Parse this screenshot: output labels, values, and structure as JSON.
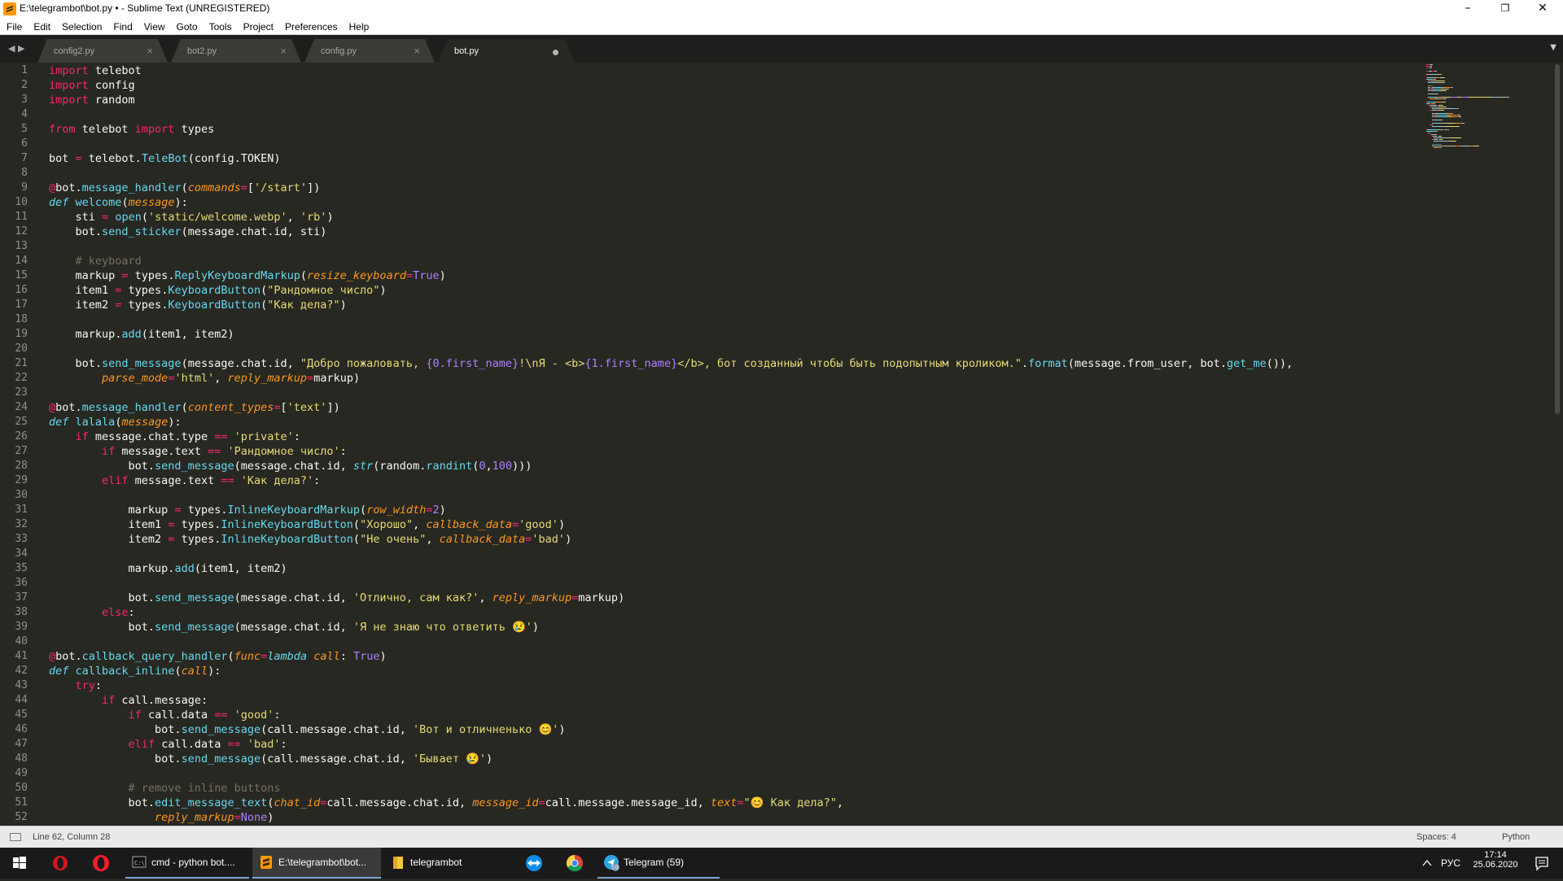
{
  "window": {
    "title": "E:\\telegrambot\\bot.py • - Sublime Text (UNREGISTERED)",
    "minimize": "–",
    "maximize": "❐",
    "close": "✕"
  },
  "menu": [
    "File",
    "Edit",
    "Selection",
    "Find",
    "View",
    "Goto",
    "Tools",
    "Project",
    "Preferences",
    "Help"
  ],
  "tabs": [
    {
      "label": "config2.py",
      "close": "×",
      "active": false
    },
    {
      "label": "bot2.py",
      "close": "×",
      "active": false
    },
    {
      "label": "config.py",
      "close": "×",
      "active": false
    },
    {
      "label": "bot.py",
      "close": "●",
      "active": true
    }
  ],
  "tab_nav": {
    "left": "◀",
    "right": "▶",
    "dropdown": "▼"
  },
  "code": {
    "line_numbers": [
      "1",
      "2",
      "3",
      "4",
      "5",
      "6",
      "7",
      "8",
      "9",
      "10",
      "11",
      "12",
      "13",
      "14",
      "15",
      "16",
      "17",
      "18",
      "19",
      "20",
      "21",
      "22",
      "23",
      "24",
      "25",
      "26",
      "27",
      "28",
      "29",
      "30",
      "31",
      "32",
      "33",
      "34",
      "35",
      "36",
      "37",
      "38",
      "39",
      "40",
      "41",
      "42",
      "43",
      "44",
      "45",
      "46",
      "47",
      "48",
      "49",
      "50",
      "51",
      "52"
    ],
    "lines": [
      [
        [
          "k",
          "import"
        ],
        [
          "n",
          " telebot"
        ]
      ],
      [
        [
          "k",
          "import"
        ],
        [
          "n",
          " config"
        ]
      ],
      [
        [
          "k",
          "import"
        ],
        [
          "n",
          " random"
        ]
      ],
      [],
      [
        [
          "k",
          "from"
        ],
        [
          "n",
          " telebot "
        ],
        [
          "k",
          "import"
        ],
        [
          "n",
          " types"
        ]
      ],
      [],
      [
        [
          "n",
          "bot "
        ],
        [
          "k",
          "="
        ],
        [
          "n",
          " telebot."
        ],
        [
          "f",
          "TeleBot"
        ],
        [
          "n",
          "(config.TOKEN)"
        ]
      ],
      [],
      [
        [
          "k",
          "@"
        ],
        [
          "n",
          "bot."
        ],
        [
          "f",
          "message_handler"
        ],
        [
          "n",
          "("
        ],
        [
          "p",
          "commands"
        ],
        [
          "k",
          "="
        ],
        [
          "n",
          "["
        ],
        [
          "s",
          "'/start'"
        ],
        [
          "n",
          "])"
        ]
      ],
      [
        [
          "d",
          "def"
        ],
        [
          "n",
          " "
        ],
        [
          "f",
          "welcome"
        ],
        [
          "n",
          "("
        ],
        [
          "p",
          "message"
        ],
        [
          "n",
          "):"
        ]
      ],
      [
        [
          "n",
          "    sti "
        ],
        [
          "k",
          "="
        ],
        [
          "n",
          " "
        ],
        [
          "f",
          "open"
        ],
        [
          "n",
          "("
        ],
        [
          "s",
          "'static/welcome.webp'"
        ],
        [
          "n",
          ", "
        ],
        [
          "s",
          "'rb'"
        ],
        [
          "n",
          ")"
        ]
      ],
      [
        [
          "n",
          "    bot."
        ],
        [
          "f",
          "send_sticker"
        ],
        [
          "n",
          "(message.chat.id, sti)"
        ]
      ],
      [],
      [
        [
          "c",
          "    # keyboard"
        ]
      ],
      [
        [
          "n",
          "    markup "
        ],
        [
          "k",
          "="
        ],
        [
          "n",
          " types."
        ],
        [
          "f",
          "ReplyKeyboardMarkup"
        ],
        [
          "n",
          "("
        ],
        [
          "p",
          "resize_keyboard"
        ],
        [
          "k",
          "="
        ],
        [
          "v",
          "True"
        ],
        [
          "n",
          ")"
        ]
      ],
      [
        [
          "n",
          "    item1 "
        ],
        [
          "k",
          "="
        ],
        [
          "n",
          " types."
        ],
        [
          "f",
          "KeyboardButton"
        ],
        [
          "n",
          "("
        ],
        [
          "s",
          "\"Рандомное число\""
        ],
        [
          "n",
          ")"
        ]
      ],
      [
        [
          "n",
          "    item2 "
        ],
        [
          "k",
          "="
        ],
        [
          "n",
          " types."
        ],
        [
          "f",
          "KeyboardButton"
        ],
        [
          "n",
          "("
        ],
        [
          "s",
          "\"Как дела?\""
        ],
        [
          "n",
          ")"
        ]
      ],
      [],
      [
        [
          "n",
          "    markup."
        ],
        [
          "f",
          "add"
        ],
        [
          "n",
          "(item1, item2)"
        ]
      ],
      [],
      [
        [
          "n",
          "    bot."
        ],
        [
          "f",
          "send_message"
        ],
        [
          "n",
          "(message.chat.id, "
        ],
        [
          "s",
          "\"Добро пожаловать, "
        ],
        [
          "v",
          "{0.first_name}"
        ],
        [
          "s",
          "!\\nЯ - <b>"
        ],
        [
          "v",
          "{1.first_name}"
        ],
        [
          "s",
          "</b>, бот созданный чтобы быть подопытным кроликом.\""
        ],
        [
          "n",
          "."
        ],
        [
          "f",
          "format"
        ],
        [
          "n",
          "(message.from_user, bot."
        ],
        [
          "f",
          "get_me"
        ],
        [
          "n",
          "()),"
        ]
      ],
      [
        [
          "n",
          "        "
        ],
        [
          "p",
          "parse_mode"
        ],
        [
          "k",
          "="
        ],
        [
          "s",
          "'html'"
        ],
        [
          "n",
          ", "
        ],
        [
          "p",
          "reply_markup"
        ],
        [
          "k",
          "="
        ],
        [
          "n",
          "markup)"
        ]
      ],
      [],
      [
        [
          "k",
          "@"
        ],
        [
          "n",
          "bot."
        ],
        [
          "f",
          "message_handler"
        ],
        [
          "n",
          "("
        ],
        [
          "p",
          "content_types"
        ],
        [
          "k",
          "="
        ],
        [
          "n",
          "["
        ],
        [
          "s",
          "'text'"
        ],
        [
          "n",
          "])"
        ]
      ],
      [
        [
          "d",
          "def"
        ],
        [
          "n",
          " "
        ],
        [
          "f",
          "lalala"
        ],
        [
          "n",
          "("
        ],
        [
          "p",
          "message"
        ],
        [
          "n",
          "):"
        ]
      ],
      [
        [
          "n",
          "    "
        ],
        [
          "k",
          "if"
        ],
        [
          "n",
          " message.chat.type "
        ],
        [
          "k",
          "=="
        ],
        [
          "n",
          " "
        ],
        [
          "s",
          "'private'"
        ],
        [
          "n",
          ":"
        ]
      ],
      [
        [
          "n",
          "        "
        ],
        [
          "k",
          "if"
        ],
        [
          "n",
          " message.text "
        ],
        [
          "k",
          "=="
        ],
        [
          "n",
          " "
        ],
        [
          "s",
          "'Рандомное число'"
        ],
        [
          "n",
          ":"
        ]
      ],
      [
        [
          "n",
          "            bot."
        ],
        [
          "f",
          "send_message"
        ],
        [
          "n",
          "(message.chat.id, "
        ],
        [
          "d",
          "str"
        ],
        [
          "n",
          "(random."
        ],
        [
          "f",
          "randint"
        ],
        [
          "n",
          "("
        ],
        [
          "v",
          "0"
        ],
        [
          "n",
          ","
        ],
        [
          "v",
          "100"
        ],
        [
          "n",
          ")))"
        ]
      ],
      [
        [
          "n",
          "        "
        ],
        [
          "k",
          "elif"
        ],
        [
          "n",
          " message.text "
        ],
        [
          "k",
          "=="
        ],
        [
          "n",
          " "
        ],
        [
          "s",
          "'Как дела?'"
        ],
        [
          "n",
          ":"
        ]
      ],
      [],
      [
        [
          "n",
          "            markup "
        ],
        [
          "k",
          "="
        ],
        [
          "n",
          " types."
        ],
        [
          "f",
          "InlineKeyboardMarkup"
        ],
        [
          "n",
          "("
        ],
        [
          "p",
          "row_width"
        ],
        [
          "k",
          "="
        ],
        [
          "v",
          "2"
        ],
        [
          "n",
          ")"
        ]
      ],
      [
        [
          "n",
          "            item1 "
        ],
        [
          "k",
          "="
        ],
        [
          "n",
          " types."
        ],
        [
          "f",
          "InlineKeyboardButton"
        ],
        [
          "n",
          "("
        ],
        [
          "s",
          "\"Хорошо\""
        ],
        [
          "n",
          ", "
        ],
        [
          "p",
          "callback_data"
        ],
        [
          "k",
          "="
        ],
        [
          "s",
          "'good'"
        ],
        [
          "n",
          ")"
        ]
      ],
      [
        [
          "n",
          "            item2 "
        ],
        [
          "k",
          "="
        ],
        [
          "n",
          " types."
        ],
        [
          "f",
          "InlineKeyboardButton"
        ],
        [
          "n",
          "("
        ],
        [
          "s",
          "\"Не очень\""
        ],
        [
          "n",
          ", "
        ],
        [
          "p",
          "callback_data"
        ],
        [
          "k",
          "="
        ],
        [
          "s",
          "'bad'"
        ],
        [
          "n",
          ")"
        ]
      ],
      [],
      [
        [
          "n",
          "            markup."
        ],
        [
          "f",
          "add"
        ],
        [
          "n",
          "(item1, item2)"
        ]
      ],
      [],
      [
        [
          "n",
          "            bot."
        ],
        [
          "f",
          "send_message"
        ],
        [
          "n",
          "(message.chat.id, "
        ],
        [
          "s",
          "'Отлично, сам как?'"
        ],
        [
          "n",
          ", "
        ],
        [
          "p",
          "reply_markup"
        ],
        [
          "k",
          "="
        ],
        [
          "n",
          "markup)"
        ]
      ],
      [
        [
          "n",
          "        "
        ],
        [
          "k",
          "else"
        ],
        [
          "n",
          ":"
        ]
      ],
      [
        [
          "n",
          "            bot."
        ],
        [
          "f",
          "send_message"
        ],
        [
          "n",
          "(message.chat.id, "
        ],
        [
          "s",
          "'Я не знаю что ответить 😢'"
        ],
        [
          "n",
          ")"
        ]
      ],
      [],
      [
        [
          "k",
          "@"
        ],
        [
          "n",
          "bot."
        ],
        [
          "f",
          "callback_query_handler"
        ],
        [
          "n",
          "("
        ],
        [
          "p",
          "func"
        ],
        [
          "k",
          "="
        ],
        [
          "d",
          "lambda"
        ],
        [
          "n",
          " "
        ],
        [
          "p",
          "call"
        ],
        [
          "n",
          ": "
        ],
        [
          "v",
          "True"
        ],
        [
          "n",
          ")"
        ]
      ],
      [
        [
          "d",
          "def"
        ],
        [
          "n",
          " "
        ],
        [
          "f",
          "callback_inline"
        ],
        [
          "n",
          "("
        ],
        [
          "p",
          "call"
        ],
        [
          "n",
          "):"
        ]
      ],
      [
        [
          "n",
          "    "
        ],
        [
          "k",
          "try"
        ],
        [
          "n",
          ":"
        ]
      ],
      [
        [
          "n",
          "        "
        ],
        [
          "k",
          "if"
        ],
        [
          "n",
          " call.message:"
        ]
      ],
      [
        [
          "n",
          "            "
        ],
        [
          "k",
          "if"
        ],
        [
          "n",
          " call.data "
        ],
        [
          "k",
          "=="
        ],
        [
          "n",
          " "
        ],
        [
          "s",
          "'good'"
        ],
        [
          "n",
          ":"
        ]
      ],
      [
        [
          "n",
          "                bot."
        ],
        [
          "f",
          "send_message"
        ],
        [
          "n",
          "(call.message.chat.id, "
        ],
        [
          "s",
          "'Вот и отличненько 😊'"
        ],
        [
          "n",
          ")"
        ]
      ],
      [
        [
          "n",
          "            "
        ],
        [
          "k",
          "elif"
        ],
        [
          "n",
          " call.data "
        ],
        [
          "k",
          "=="
        ],
        [
          "n",
          " "
        ],
        [
          "s",
          "'bad'"
        ],
        [
          "n",
          ":"
        ]
      ],
      [
        [
          "n",
          "                bot."
        ],
        [
          "f",
          "send_message"
        ],
        [
          "n",
          "(call.message.chat.id, "
        ],
        [
          "s",
          "'Бывает 😢'"
        ],
        [
          "n",
          ")"
        ]
      ],
      [],
      [
        [
          "c",
          "            # remove inline buttons"
        ]
      ],
      [
        [
          "n",
          "            bot."
        ],
        [
          "f",
          "edit_message_text"
        ],
        [
          "n",
          "("
        ],
        [
          "p",
          "chat_id"
        ],
        [
          "k",
          "="
        ],
        [
          "n",
          "call.message.chat.id, "
        ],
        [
          "p",
          "message_id"
        ],
        [
          "k",
          "="
        ],
        [
          "n",
          "call.message.message_id, "
        ],
        [
          "p",
          "text"
        ],
        [
          "k",
          "="
        ],
        [
          "s",
          "\"😊 Как дела?\""
        ],
        [
          "n",
          ","
        ]
      ],
      [
        [
          "n",
          "                "
        ],
        [
          "p",
          "reply_markup"
        ],
        [
          "k",
          "="
        ],
        [
          "v",
          "None"
        ],
        [
          "n",
          ")"
        ]
      ]
    ]
  },
  "status": {
    "position": "Line 62, Column 28",
    "spaces": "Spaces: 4",
    "syntax": "Python"
  },
  "taskbar": {
    "tasks": [
      {
        "label": "cmd - python  bot....",
        "icon": "cmd-icon",
        "active": false
      },
      {
        "label": "E:\\telegrambot\\bot...",
        "icon": "sublime-icon",
        "active": true
      },
      {
        "label": "telegrambot",
        "icon": "folder-icon",
        "active": false
      },
      {
        "label": "Telegram (59)",
        "icon": "telegram-icon",
        "active": false
      }
    ],
    "pinned": [
      "opera-gx-icon",
      "opera-icon",
      "teamviewer-icon",
      "chrome-icon"
    ],
    "language": "РУС",
    "time": "17:14",
    "date": "25.06.2020",
    "telegram_badge": "59"
  },
  "colors": {
    "editor_bg": "#272822",
    "keyword": "#f92672",
    "string": "#e6db74",
    "comment": "#75715e",
    "function": "#66d9ef",
    "param": "#fd971f",
    "constant": "#ae81ff"
  }
}
